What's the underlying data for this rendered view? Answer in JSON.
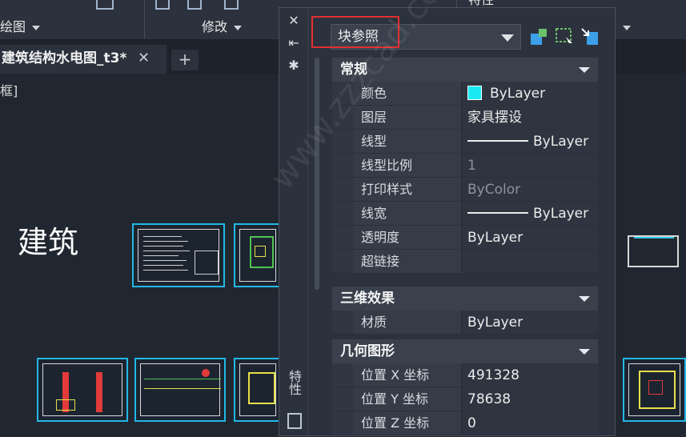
{
  "ribbon": {
    "groups": [
      {
        "label": "绘图",
        "has_caret": true
      },
      {
        "label": "修改",
        "has_caret": true
      },
      {
        "label": "特性",
        "has_caret": false
      }
    ]
  },
  "file_tabs": {
    "active_title": "建筑结构水电图_t3*",
    "close_glyph": "✕",
    "add_glyph": "+"
  },
  "canvas": {
    "view_label": "框]",
    "drawing_label": "建筑",
    "sheet_border_color": "#22b8e6"
  },
  "palette": {
    "title": "特性",
    "object_type": "块参照",
    "highlight_color": "#e03030",
    "strip_icons": [
      "close-icon",
      "pin-icon",
      "gear-icon"
    ],
    "toolbar_icons": [
      "quick-select-icon",
      "select-objects-icon",
      "pickadd-toggle-icon"
    ],
    "sections": {
      "general": {
        "title": "常规",
        "rows": [
          {
            "label": "颜色",
            "value": "ByLayer",
            "swatch": "#19e9f2"
          },
          {
            "label": "图层",
            "value": "家具摆设"
          },
          {
            "label": "线型",
            "value": "ByLayer",
            "line_sample": true
          },
          {
            "label": "线型比例",
            "value": "1"
          },
          {
            "label": "打印样式",
            "value": "ByColor",
            "dimmed": true
          },
          {
            "label": "线宽",
            "value": "ByLayer",
            "line_sample": true
          },
          {
            "label": "透明度",
            "value": "ByLayer"
          },
          {
            "label": "超链接",
            "value": ""
          }
        ]
      },
      "threed": {
        "title": "三维效果",
        "rows": [
          {
            "label": "材质",
            "value": "ByLayer"
          }
        ]
      },
      "geometry": {
        "title": "几何图形",
        "rows": [
          {
            "label": "位置 X 坐标",
            "value": "491328"
          },
          {
            "label": "位置 Y 坐标",
            "value": "78638"
          },
          {
            "label": "位置 Z 坐标",
            "value": "0"
          }
        ]
      }
    }
  },
  "watermark": "www.zzzcad.com 自学站长"
}
